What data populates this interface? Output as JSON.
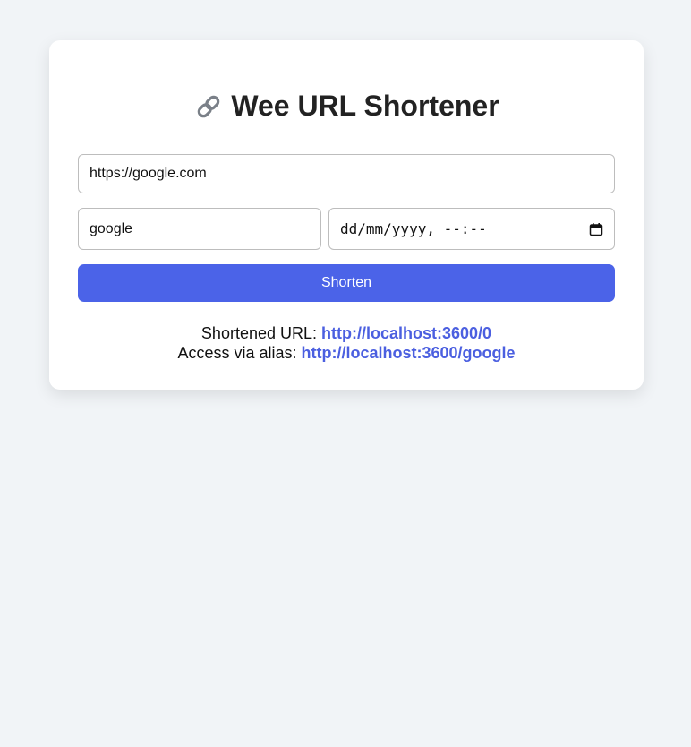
{
  "app": {
    "title": "Wee URL Shortener",
    "title_icon": "link-icon"
  },
  "form": {
    "url_value": "https://google.com",
    "alias_value": "google",
    "date_value": "dd/mm/yyyy, --:--",
    "date_icon": "calendar-icon",
    "submit_label": "Shorten"
  },
  "result": {
    "shortened_label": "Shortened URL:",
    "shortened_link": "http://localhost:3600/0",
    "alias_label": "Access via alias:",
    "alias_link": "http://localhost:3600/google"
  },
  "colors": {
    "accent": "#4b63e8",
    "link": "#4b5fe0",
    "background": "#f1f4f7"
  }
}
